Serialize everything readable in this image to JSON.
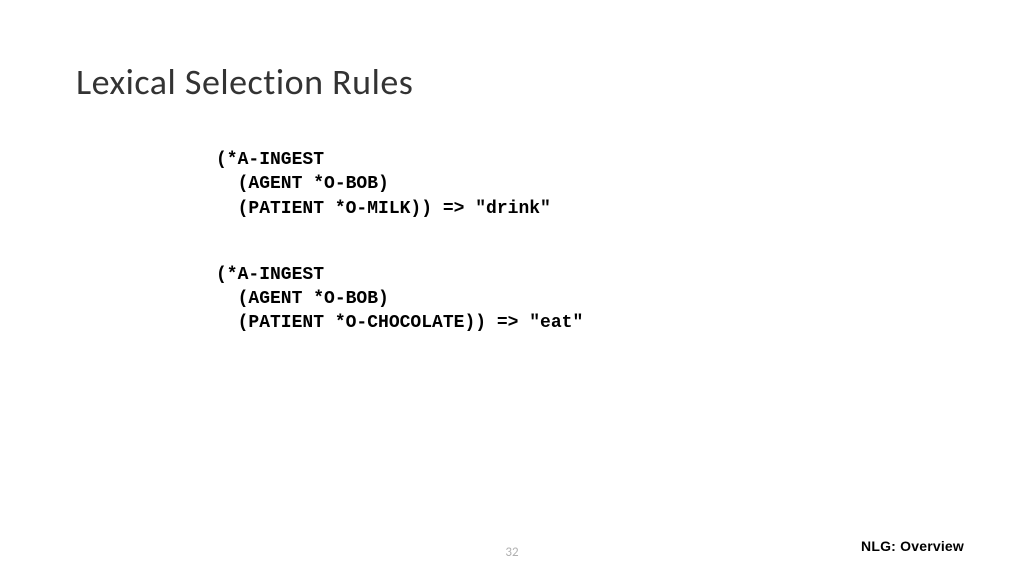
{
  "title": "Lexical Selection Rules",
  "rules": {
    "rule1_line1": "(*A-INGEST",
    "rule1_line2": "  (AGENT *O-BOB)",
    "rule1_line3": "  (PATIENT *O-MILK)) => \"drink\"",
    "rule2_line1": "(*A-INGEST",
    "rule2_line2": "  (AGENT *O-BOB)",
    "rule2_line3": "  (PATIENT *O-CHOCOLATE)) => \"eat\""
  },
  "footer": "NLG: Overview",
  "page_number": "32"
}
